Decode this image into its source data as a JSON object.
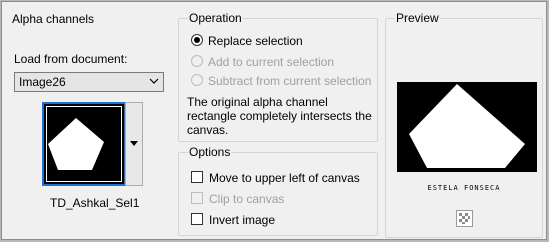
{
  "alpha_channels": {
    "title": "Alpha channels",
    "load_label": "Load from document:",
    "document_value": "Image26",
    "selection_name": "TD_Ashkal_Sel1"
  },
  "operation": {
    "title": "Operation",
    "options": [
      {
        "label": "Replace selection",
        "checked": true,
        "enabled": true
      },
      {
        "label": "Add to current selection",
        "checked": false,
        "enabled": false
      },
      {
        "label": "Subtract from current selection",
        "checked": false,
        "enabled": false
      }
    ],
    "info": "The original alpha channel rectangle completely intersects the canvas."
  },
  "options": {
    "title": "Options",
    "items": [
      {
        "label": "Move to upper left of canvas",
        "checked": false,
        "enabled": true
      },
      {
        "label": "Clip to canvas",
        "checked": false,
        "enabled": false
      },
      {
        "label": "Invert image",
        "checked": false,
        "enabled": true
      }
    ]
  },
  "preview": {
    "title": "Preview",
    "signature": "ESTELA FONSECA"
  },
  "colors": {
    "selection_border": "#1e6fd9",
    "canvas_bg": "#000000",
    "shape": "#ffffff"
  }
}
